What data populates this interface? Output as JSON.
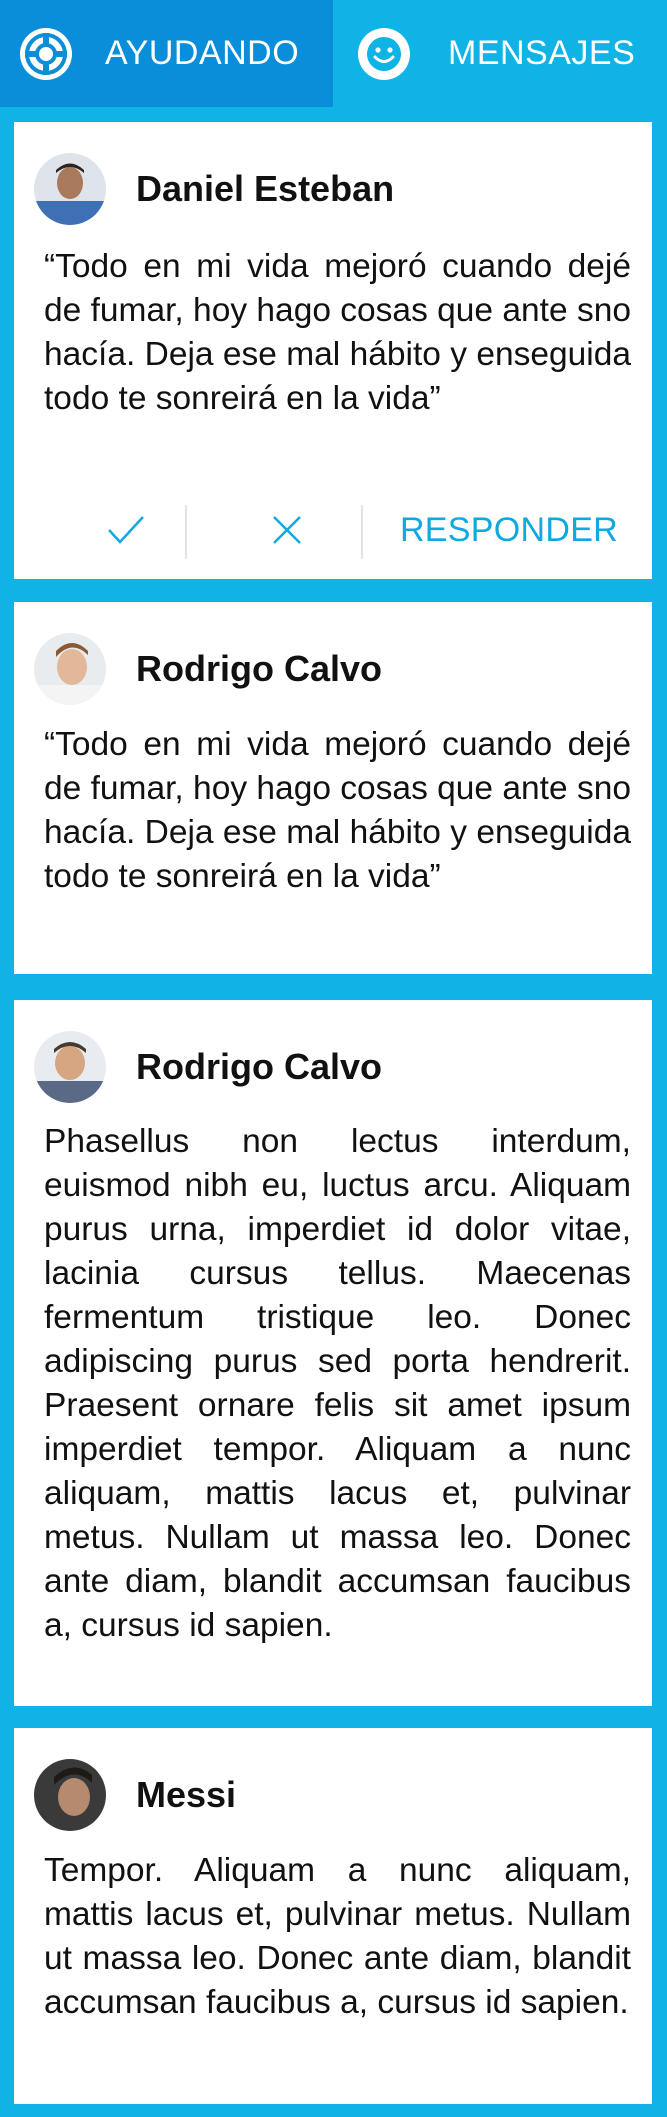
{
  "tabs": [
    {
      "label": "AYUDANDO",
      "icon": "lifebuoy-icon",
      "active": true
    },
    {
      "label": "MENSAJES",
      "icon": "smiley-icon",
      "active": false
    }
  ],
  "colors": {
    "background": "#0fb3e6",
    "active_tab": "#0a8ed9",
    "accent": "#11a8e0"
  },
  "messages": [
    {
      "author": "Daniel Esteban",
      "text": "“Todo en mi vida mejoró cuando dejé de fumar, hoy hago cosas que ante sno hacía. Deja ese mal hábito y enseguida todo te sonreirá en la vida”",
      "actions": {
        "approve_icon": "check-icon",
        "reject_icon": "close-icon",
        "reply_label": "RESPONDER"
      }
    },
    {
      "author": "Rodrigo Calvo",
      "text": "“Todo en mi vida mejoró cuando dejé de fumar, hoy hago cosas que ante sno hacía. Deja ese mal hábito y enseguida todo te sonreirá en la vida”"
    },
    {
      "author": "Rodrigo Calvo",
      "text": "Phasellus non lectus interdum, euismod nibh eu, luctus arcu. Aliquam purus urna, imperdiet id dolor vitae, lacinia cursus tellus. Maecenas fermentum tristique leo. Donec adipiscing purus sed porta hendrerit. Praesent ornare felis sit amet ipsum imperdiet tempor. Aliquam a nunc aliquam, mattis lacus et, pulvinar metus. Nullam ut massa leo. Donec ante diam, blandit accumsan faucibus a, cursus id sapien."
    },
    {
      "author": "Messi",
      "text": "Tempor. Aliquam a nunc aliquam, mattis lacus et, pulvinar metus. Nullam ut massa leo. Donec ante diam, blandit accumsan faucibus a, cursus id sapien."
    }
  ]
}
